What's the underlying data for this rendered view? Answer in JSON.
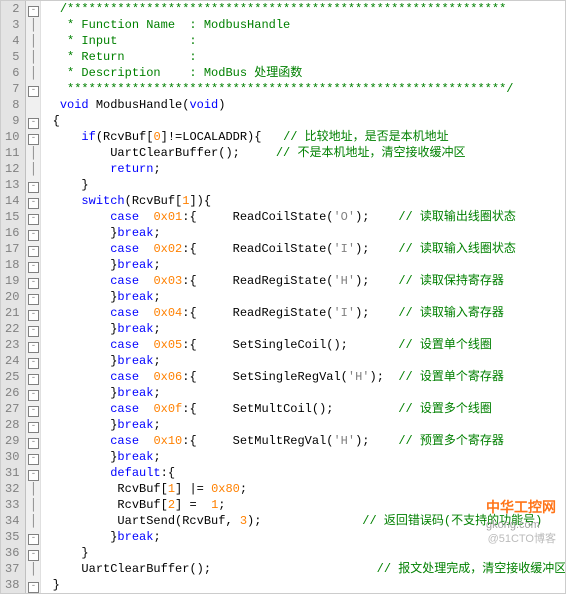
{
  "lines": [
    {
      "n": 2,
      "f": "-",
      "t": "  ",
      "s": [
        {
          "c": "cm",
          "v": "/*************************************************************"
        }
      ]
    },
    {
      "n": 3,
      "f": "|",
      "t": "  ",
      "s": [
        {
          "c": "cm",
          "v": " * Function Name  : ModbusHandle"
        }
      ]
    },
    {
      "n": 4,
      "f": "|",
      "t": "  ",
      "s": [
        {
          "c": "cm",
          "v": " * Input          :"
        }
      ]
    },
    {
      "n": 5,
      "f": "|",
      "t": "  ",
      "s": [
        {
          "c": "cm",
          "v": " * Return         :"
        }
      ]
    },
    {
      "n": 6,
      "f": "|",
      "t": "  ",
      "s": [
        {
          "c": "cm",
          "v": " * Description    : ModBus 处理函数"
        }
      ]
    },
    {
      "n": 7,
      "f": "-",
      "t": "  ",
      "s": [
        {
          "c": "cm",
          "v": " *************************************************************/"
        }
      ]
    },
    {
      "n": 8,
      "f": "",
      "t": "  ",
      "s": [
        {
          "c": "kw",
          "v": "void"
        },
        {
          "c": "id",
          "v": " ModbusHandle("
        },
        {
          "c": "kw",
          "v": "void"
        },
        {
          "c": "id",
          "v": ")"
        }
      ]
    },
    {
      "n": 9,
      "f": "-",
      "t": " ",
      "s": [
        {
          "c": "id",
          "v": "{"
        }
      ]
    },
    {
      "n": 10,
      "f": "-",
      "t": "     ",
      "s": [
        {
          "c": "kw",
          "v": "if"
        },
        {
          "c": "id",
          "v": "(RcvBuf["
        },
        {
          "c": "num",
          "v": "0"
        },
        {
          "c": "id",
          "v": "]!=LOCALADDR){   "
        },
        {
          "c": "cm",
          "v": "// 比较地址，是否是本机地址"
        }
      ]
    },
    {
      "n": 11,
      "f": "|",
      "t": "         ",
      "s": [
        {
          "c": "id",
          "v": "UartClearBuffer();     "
        },
        {
          "c": "cm",
          "v": "// 不是本机地址，清空接收缓冲区"
        }
      ]
    },
    {
      "n": 12,
      "f": "|",
      "t": "         ",
      "s": [
        {
          "c": "kw",
          "v": "return"
        },
        {
          "c": "id",
          "v": ";"
        }
      ]
    },
    {
      "n": 13,
      "f": "-",
      "t": "     ",
      "s": [
        {
          "c": "id",
          "v": "}"
        }
      ]
    },
    {
      "n": 14,
      "f": "-",
      "t": "     ",
      "s": [
        {
          "c": "kw",
          "v": "switch"
        },
        {
          "c": "id",
          "v": "(RcvBuf["
        },
        {
          "c": "num",
          "v": "1"
        },
        {
          "c": "id",
          "v": "]){"
        }
      ]
    },
    {
      "n": 15,
      "f": "-",
      "t": "         ",
      "s": [
        {
          "c": "kw",
          "v": "case"
        },
        {
          "c": "id",
          "v": "  "
        },
        {
          "c": "num",
          "v": "0x01"
        },
        {
          "c": "id",
          "v": ":{     ReadCoilState("
        },
        {
          "c": "str",
          "v": "'O'"
        },
        {
          "c": "id",
          "v": ");    "
        },
        {
          "c": "cm",
          "v": "// 读取输出线圈状态"
        }
      ]
    },
    {
      "n": 16,
      "f": "-",
      "t": "         ",
      "s": [
        {
          "c": "id",
          "v": "}"
        },
        {
          "c": "kw",
          "v": "break"
        },
        {
          "c": "id",
          "v": ";"
        }
      ]
    },
    {
      "n": 17,
      "f": "-",
      "t": "         ",
      "s": [
        {
          "c": "kw",
          "v": "case"
        },
        {
          "c": "id",
          "v": "  "
        },
        {
          "c": "num",
          "v": "0x02"
        },
        {
          "c": "id",
          "v": ":{     ReadCoilState("
        },
        {
          "c": "str",
          "v": "'I'"
        },
        {
          "c": "id",
          "v": ");    "
        },
        {
          "c": "cm",
          "v": "// 读取输入线圈状态"
        }
      ]
    },
    {
      "n": 18,
      "f": "-",
      "t": "         ",
      "s": [
        {
          "c": "id",
          "v": "}"
        },
        {
          "c": "kw",
          "v": "break"
        },
        {
          "c": "id",
          "v": ";"
        }
      ]
    },
    {
      "n": 19,
      "f": "-",
      "t": "         ",
      "s": [
        {
          "c": "kw",
          "v": "case"
        },
        {
          "c": "id",
          "v": "  "
        },
        {
          "c": "num",
          "v": "0x03"
        },
        {
          "c": "id",
          "v": ":{     ReadRegiState("
        },
        {
          "c": "str",
          "v": "'H'"
        },
        {
          "c": "id",
          "v": ");    "
        },
        {
          "c": "cm",
          "v": "// 读取保持寄存器"
        }
      ]
    },
    {
      "n": 20,
      "f": "-",
      "t": "         ",
      "s": [
        {
          "c": "id",
          "v": "}"
        },
        {
          "c": "kw",
          "v": "break"
        },
        {
          "c": "id",
          "v": ";"
        }
      ]
    },
    {
      "n": 21,
      "f": "-",
      "t": "         ",
      "s": [
        {
          "c": "kw",
          "v": "case"
        },
        {
          "c": "id",
          "v": "  "
        },
        {
          "c": "num",
          "v": "0x04"
        },
        {
          "c": "id",
          "v": ":{     ReadRegiState("
        },
        {
          "c": "str",
          "v": "'I'"
        },
        {
          "c": "id",
          "v": ");    "
        },
        {
          "c": "cm",
          "v": "// 读取输入寄存器"
        }
      ]
    },
    {
      "n": 22,
      "f": "-",
      "t": "         ",
      "s": [
        {
          "c": "id",
          "v": "}"
        },
        {
          "c": "kw",
          "v": "break"
        },
        {
          "c": "id",
          "v": ";"
        }
      ]
    },
    {
      "n": 23,
      "f": "-",
      "t": "         ",
      "s": [
        {
          "c": "kw",
          "v": "case"
        },
        {
          "c": "id",
          "v": "  "
        },
        {
          "c": "num",
          "v": "0x05"
        },
        {
          "c": "id",
          "v": ":{     SetSingleCoil();       "
        },
        {
          "c": "cm",
          "v": "// 设置单个线圈"
        }
      ]
    },
    {
      "n": 24,
      "f": "-",
      "t": "         ",
      "s": [
        {
          "c": "id",
          "v": "}"
        },
        {
          "c": "kw",
          "v": "break"
        },
        {
          "c": "id",
          "v": ";"
        }
      ]
    },
    {
      "n": 25,
      "f": "-",
      "t": "         ",
      "s": [
        {
          "c": "kw",
          "v": "case"
        },
        {
          "c": "id",
          "v": "  "
        },
        {
          "c": "num",
          "v": "0x06"
        },
        {
          "c": "id",
          "v": ":{     SetSingleRegVal("
        },
        {
          "c": "str",
          "v": "'H'"
        },
        {
          "c": "id",
          "v": ");  "
        },
        {
          "c": "cm",
          "v": "// 设置单个寄存器"
        }
      ]
    },
    {
      "n": 26,
      "f": "-",
      "t": "         ",
      "s": [
        {
          "c": "id",
          "v": "}"
        },
        {
          "c": "kw",
          "v": "break"
        },
        {
          "c": "id",
          "v": ";"
        }
      ]
    },
    {
      "n": 27,
      "f": "-",
      "t": "         ",
      "s": [
        {
          "c": "kw",
          "v": "case"
        },
        {
          "c": "id",
          "v": "  "
        },
        {
          "c": "num",
          "v": "0x0f"
        },
        {
          "c": "id",
          "v": ":{     SetMultCoil();         "
        },
        {
          "c": "cm",
          "v": "// 设置多个线圈"
        }
      ]
    },
    {
      "n": 28,
      "f": "-",
      "t": "         ",
      "s": [
        {
          "c": "id",
          "v": "}"
        },
        {
          "c": "kw",
          "v": "break"
        },
        {
          "c": "id",
          "v": ";"
        }
      ]
    },
    {
      "n": 29,
      "f": "-",
      "t": "         ",
      "s": [
        {
          "c": "kw",
          "v": "case"
        },
        {
          "c": "id",
          "v": "  "
        },
        {
          "c": "num",
          "v": "0x10"
        },
        {
          "c": "id",
          "v": ":{     SetMultRegVal("
        },
        {
          "c": "str",
          "v": "'H'"
        },
        {
          "c": "id",
          "v": ");    "
        },
        {
          "c": "cm",
          "v": "// 预置多个寄存器"
        }
      ]
    },
    {
      "n": 30,
      "f": "-",
      "t": "         ",
      "s": [
        {
          "c": "id",
          "v": "}"
        },
        {
          "c": "kw",
          "v": "break"
        },
        {
          "c": "id",
          "v": ";"
        }
      ]
    },
    {
      "n": 31,
      "f": "-",
      "t": "         ",
      "s": [
        {
          "c": "kw",
          "v": "default"
        },
        {
          "c": "id",
          "v": ":{"
        }
      ]
    },
    {
      "n": 32,
      "f": "|",
      "t": "          ",
      "s": [
        {
          "c": "id",
          "v": "RcvBuf["
        },
        {
          "c": "num",
          "v": "1"
        },
        {
          "c": "id",
          "v": "] |= "
        },
        {
          "c": "num",
          "v": "0x80"
        },
        {
          "c": "id",
          "v": ";"
        }
      ]
    },
    {
      "n": 33,
      "f": "|",
      "t": "          ",
      "s": [
        {
          "c": "id",
          "v": "RcvBuf["
        },
        {
          "c": "num",
          "v": "2"
        },
        {
          "c": "id",
          "v": "] =  "
        },
        {
          "c": "num",
          "v": "1"
        },
        {
          "c": "id",
          "v": ";"
        }
      ]
    },
    {
      "n": 34,
      "f": "|",
      "t": "          ",
      "s": [
        {
          "c": "id",
          "v": "UartSend(RcvBuf, "
        },
        {
          "c": "num",
          "v": "3"
        },
        {
          "c": "id",
          "v": ");              "
        },
        {
          "c": "cm",
          "v": "// 返回错误码(不支持的功能号)"
        }
      ]
    },
    {
      "n": 35,
      "f": "-",
      "t": "         ",
      "s": [
        {
          "c": "id",
          "v": "}"
        },
        {
          "c": "kw",
          "v": "break"
        },
        {
          "c": "id",
          "v": ";"
        }
      ]
    },
    {
      "n": 36,
      "f": "-",
      "t": "     ",
      "s": [
        {
          "c": "id",
          "v": "}"
        }
      ]
    },
    {
      "n": 37,
      "f": "|",
      "t": "     ",
      "s": [
        {
          "c": "id",
          "v": "UartClearBuffer();                       "
        },
        {
          "c": "cm",
          "v": "// 报文处理完成，清空接收缓冲区"
        }
      ]
    },
    {
      "n": 38,
      "f": "-",
      "t": " ",
      "s": [
        {
          "c": "id",
          "v": "}"
        }
      ]
    }
  ],
  "watermark": {
    "brand": "中华工控网",
    "site": "gkong.com",
    "credit": "@51CTO博客"
  }
}
